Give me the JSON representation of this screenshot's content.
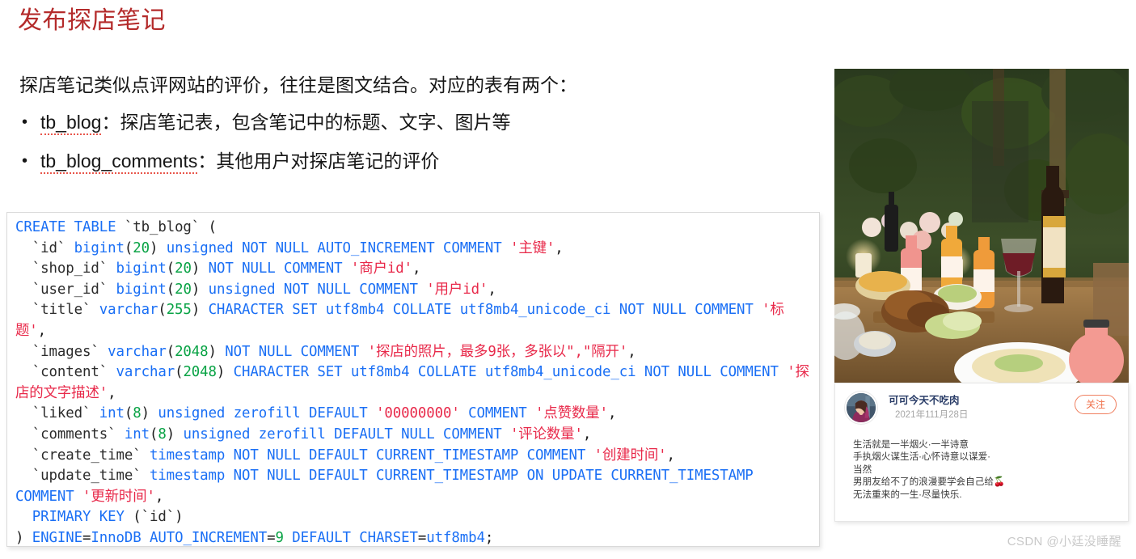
{
  "slide": {
    "title": "发布探店笔记",
    "lead": "探店笔记类似点评网站的评价，往往是图文结合。对应的表有两个：",
    "bullets": [
      {
        "marker": "•",
        "code": "tb_blog",
        "rest": "：探店笔记表，包含笔记中的标题、文字、图片等"
      },
      {
        "marker": "•",
        "code": "tb_blog_comments",
        "rest": "：其他用户对探店笔记的评价"
      }
    ]
  },
  "code_block": {
    "language": "sql",
    "lines": [
      "CREATE TABLE `tb_blog` (",
      "  `id` bigint(20) unsigned NOT NULL AUTO_INCREMENT COMMENT '主键',",
      "  `shop_id` bigint(20) NOT NULL COMMENT '商户id',",
      "  `user_id` bigint(20) unsigned NOT NULL COMMENT '用户id',",
      "  `title` varchar(255) CHARACTER SET utf8mb4 COLLATE utf8mb4_unicode_ci NOT NULL COMMENT '标题',",
      "  `images` varchar(2048) NOT NULL COMMENT '探店的照片，最多9张，多张以\",\"隔开',",
      "  `content` varchar(2048) CHARACTER SET utf8mb4 COLLATE utf8mb4_unicode_ci NOT NULL COMMENT '探店的文字描述',",
      "  `liked` int(8) unsigned zerofill DEFAULT '00000000' COMMENT '点赞数量',",
      "  `comments` int(8) unsigned zerofill DEFAULT NULL COMMENT '评论数量',",
      "  `create_time` timestamp NOT NULL DEFAULT CURRENT_TIMESTAMP COMMENT '创建时间',",
      "  `update_time` timestamp NOT NULL DEFAULT CURRENT_TIMESTAMP ON UPDATE CURRENT_TIMESTAMP COMMENT '更新时间',",
      "  PRIMARY KEY (`id`)",
      ") ENGINE=InnoDB AUTO_INCREMENT=9 DEFAULT CHARSET=utf8mb4;"
    ],
    "colors": {
      "keyword": "#1a6ff5",
      "number": "#09a345",
      "string": "#e8294a",
      "plain": "#2b2b2b"
    }
  },
  "post": {
    "photo_alt": "餐厅餐桌美食照片",
    "user_name": "可可今天不吃肉",
    "date": "2021年111月28日",
    "follow_label": "关注",
    "content_lines": [
      "生活就是一半烟火·一半诗意",
      "手执烟火谋生活·心怀诗意以谋爱·",
      "当然",
      "男朋友给不了的浪漫要学会自己给🍒",
      "无法重来的一生·尽量快乐."
    ]
  },
  "watermark": "CSDN @小廷没睡醒",
  "accents": {
    "title_red": "#b42b2b",
    "follow_orange": "#f0704a",
    "spellcheck_red": "#e8564b"
  }
}
